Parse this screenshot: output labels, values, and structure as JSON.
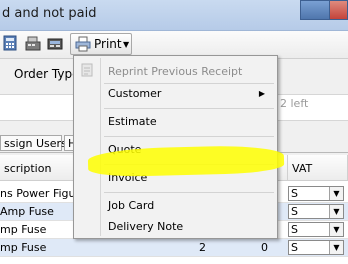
{
  "window": {
    "title": "d and not paid"
  },
  "toolbar": {
    "print_label": "Print"
  },
  "form": {
    "order_type_label": "Order Type",
    "left_hint": "2 left"
  },
  "tabs": [
    {
      "label": "ssign Users"
    },
    {
      "label": "H"
    }
  ],
  "grid": {
    "headers": {
      "description": "scription",
      "vat": "VAT"
    },
    "rows": [
      {
        "description": "ns Power Figure",
        "qty": "",
        "price": "",
        "vat": "S"
      },
      {
        "description": "Amp Fuse",
        "qty": "",
        "price": "",
        "vat": "S"
      },
      {
        "description": "mp Fuse",
        "qty": "2",
        "price": "0",
        "vat": "S"
      },
      {
        "description": "mp Fuse",
        "qty": "2",
        "price": "0",
        "vat": "S"
      }
    ]
  },
  "print_menu": {
    "items": [
      {
        "label": "Reprint Previous Receipt",
        "disabled": true
      },
      {
        "label": "Customer",
        "submenu": true
      },
      {
        "label": "Estimate"
      },
      {
        "label": "Quote"
      },
      {
        "label": "Invoice"
      },
      {
        "label": "Job Card"
      },
      {
        "label": "Delivery Note"
      }
    ]
  },
  "colors": {
    "highlight": "#ffff00",
    "row_alt": "#dfe9f7",
    "titlebar": "#c9daf0"
  }
}
